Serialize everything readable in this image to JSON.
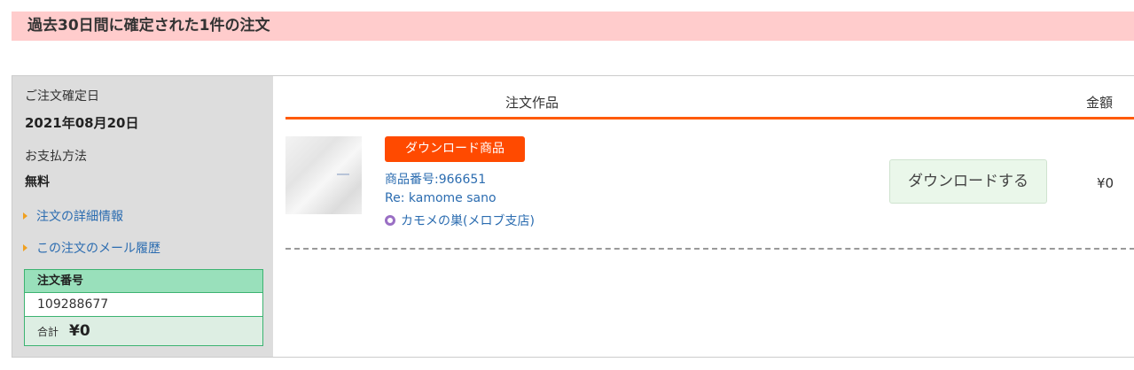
{
  "banner": {
    "title": "過去30日間に確定された1件の注文"
  },
  "sidebar": {
    "order_date_label": "ご注文確定日",
    "order_date": "2021年08月20日",
    "payment_label": "お支払方法",
    "payment_method": "無料",
    "links": [
      {
        "label": "注文の詳細情報"
      },
      {
        "label": "この注文のメール履歴"
      }
    ],
    "order_number_label": "注文番号",
    "order_number": "109288677",
    "total_label": "合計",
    "total_amount": "¥0"
  },
  "table": {
    "col_item": "注文作品",
    "col_price": "金額"
  },
  "item": {
    "tag": "ダウンロード商品",
    "product_number": "商品番号:966651",
    "title": "Re: kamome sano",
    "shop": "カモメの巣(メロブ支店)",
    "download_button": "ダウンロードする",
    "price": "¥0"
  },
  "colors": {
    "banner_bg": "#ffcccc",
    "accent_orange": "#ff4a00",
    "link_blue": "#2b6cb0",
    "order_box_green": "#3cb371"
  },
  "icons": {
    "link_arrow": "triangle-right-icon",
    "shop": "circle-ring-icon"
  }
}
